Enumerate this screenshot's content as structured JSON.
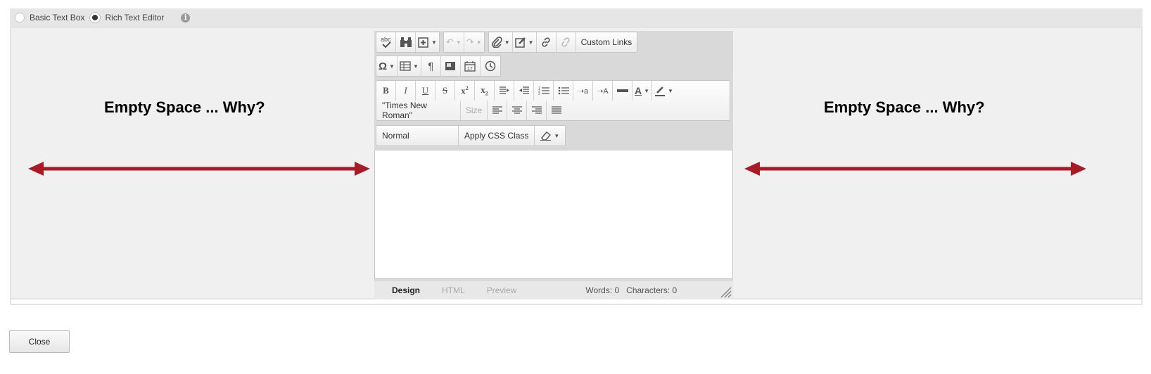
{
  "mode_bar": {
    "basic_label": "Basic Text Box",
    "rich_label": "Rich Text Editor",
    "selected": "rich",
    "info_icon": "info-icon"
  },
  "annotations": {
    "left_text": "Empty Space ... Why?",
    "right_text": "Empty Space ... Why?",
    "arrow_color": "#a81b24"
  },
  "toolbar": {
    "row1": [
      {
        "name": "spellcheck-button",
        "icon": "spellcheck-icon",
        "glyph": "abc✓"
      },
      {
        "name": "find-button",
        "icon": "binoculars-icon",
        "glyph": "⛽"
      },
      {
        "name": "insert-button",
        "icon": "plus-box-icon",
        "glyph": "⊞"
      },
      {
        "name": "undo-button",
        "icon": "undo-icon",
        "glyph": "↶"
      },
      {
        "name": "redo-button",
        "icon": "redo-icon",
        "glyph": "↷"
      },
      {
        "name": "attach-button",
        "icon": "paperclip-icon",
        "glyph": "📎"
      },
      {
        "name": "edit-button",
        "icon": "pencil-box-icon",
        "glyph": "✎"
      },
      {
        "name": "link-button",
        "icon": "link-icon",
        "glyph": "🔗"
      },
      {
        "name": "unlink-button",
        "icon": "unlink-icon",
        "glyph": "⛓"
      }
    ],
    "custom_links_label": "Custom Links",
    "font_name": "\"Times New Roman\"",
    "size_placeholder": "Size",
    "paragraph_style": "Normal",
    "apply_css_label": "Apply CSS Class"
  },
  "status": {
    "tab_design": "Design",
    "tab_html": "HTML",
    "tab_preview": "Preview",
    "words": "Words: 0",
    "characters": "Characters: 0"
  },
  "close_label": "Close"
}
